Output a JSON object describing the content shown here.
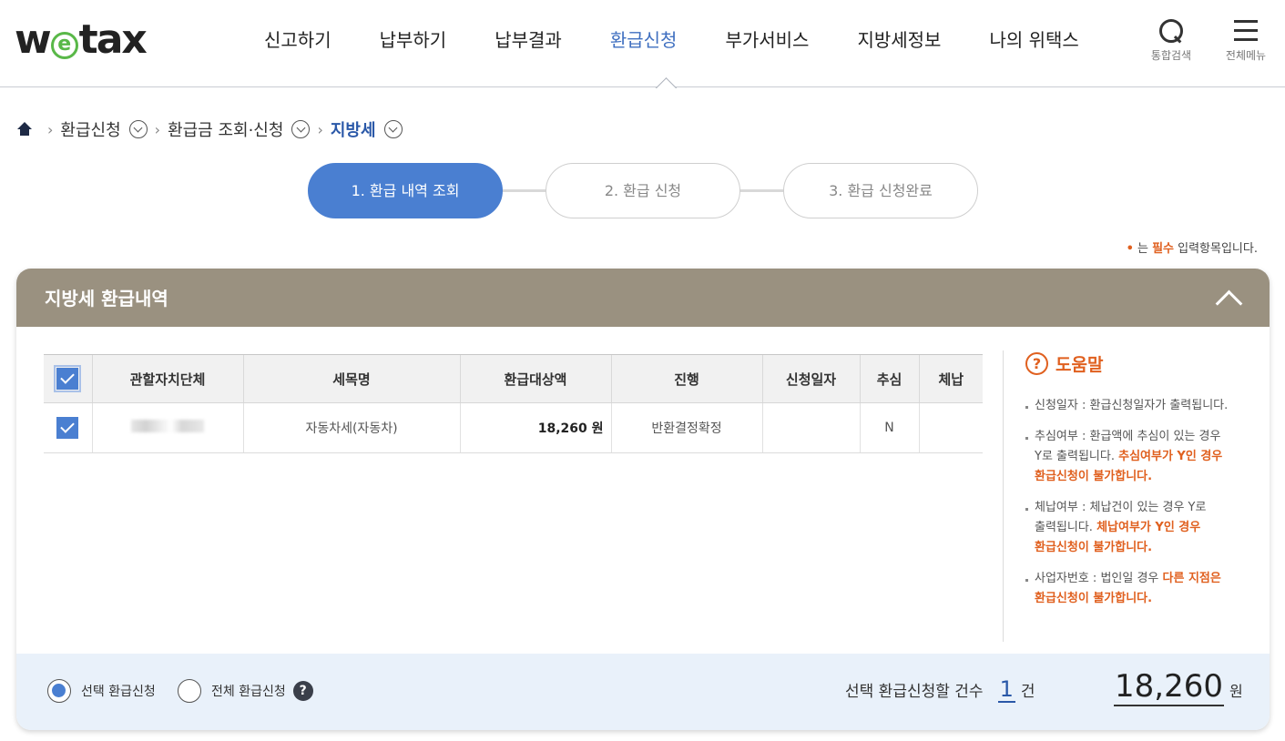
{
  "header": {
    "logo": {
      "pre": "w",
      "e": "e",
      "post": "tax"
    },
    "nav": [
      {
        "label": "신고하기"
      },
      {
        "label": "납부하기"
      },
      {
        "label": "납부결과"
      },
      {
        "label": "환급신청"
      },
      {
        "label": "부가서비스"
      },
      {
        "label": "지방세정보"
      },
      {
        "label": "나의 위택스"
      }
    ],
    "active_nav": "환급신청",
    "search_label": "통합검색",
    "menu_label": "전체메뉴"
  },
  "breadcrumb": [
    {
      "label": "환급신청"
    },
    {
      "label": "환급금 조회·신청"
    },
    {
      "label": "지방세"
    }
  ],
  "steps": [
    {
      "label": "1. 환급 내역 조회"
    },
    {
      "label": "2. 환급 신청"
    },
    {
      "label": "3. 환급 신청완료"
    }
  ],
  "required_note": {
    "mark": "•",
    "pre": "는 ",
    "required": "필수",
    "post": " 입력항목입니다."
  },
  "panel": {
    "title": "지방세 환급내역",
    "table": {
      "headers": [
        "관할자치단체",
        "세목명",
        "환급대상액",
        "진행",
        "신청일자",
        "추심",
        "체납"
      ],
      "rows": [
        {
          "jurisdiction": "",
          "tax_name": "자동차세(자동차)",
          "amount": "18,260 원",
          "status": "반환결정확정",
          "apply_date": "",
          "collection": "N",
          "arrears": ""
        }
      ]
    },
    "help": {
      "title": "도움말",
      "items": [
        {
          "text": "신청일자 : 환급신청일자가 출력됩니다.",
          "warn": ""
        },
        {
          "text": "추심여부 : 환급액에 추심이 있는 경우 Y로 출력됩니다. ",
          "warn": "추심여부가 Y인 경우 환급신청이 불가합니다."
        },
        {
          "text": "체납여부 : 체납건이 있는 경우 Y로 출력됩니다. ",
          "warn": "체납여부가 Y인 경우 환급신청이 불가합니다."
        },
        {
          "text": "사업자번호 : 법인일 경우 ",
          "warn": "다른 지점은 환급신청이 불가합니다."
        }
      ]
    },
    "footer": {
      "radio_selected": "선택 환급신청",
      "radio_all": "전체 환급신청",
      "help_q": "?",
      "count_label": "선택 환급신청할 건수",
      "count": "1",
      "count_unit": "건",
      "total": "18,260",
      "total_unit": "원"
    }
  },
  "colors": {
    "accent": "#4a7fd1",
    "panel_header": "#9a9180",
    "warning": "#e0601f",
    "logo_e": "#59b848"
  }
}
